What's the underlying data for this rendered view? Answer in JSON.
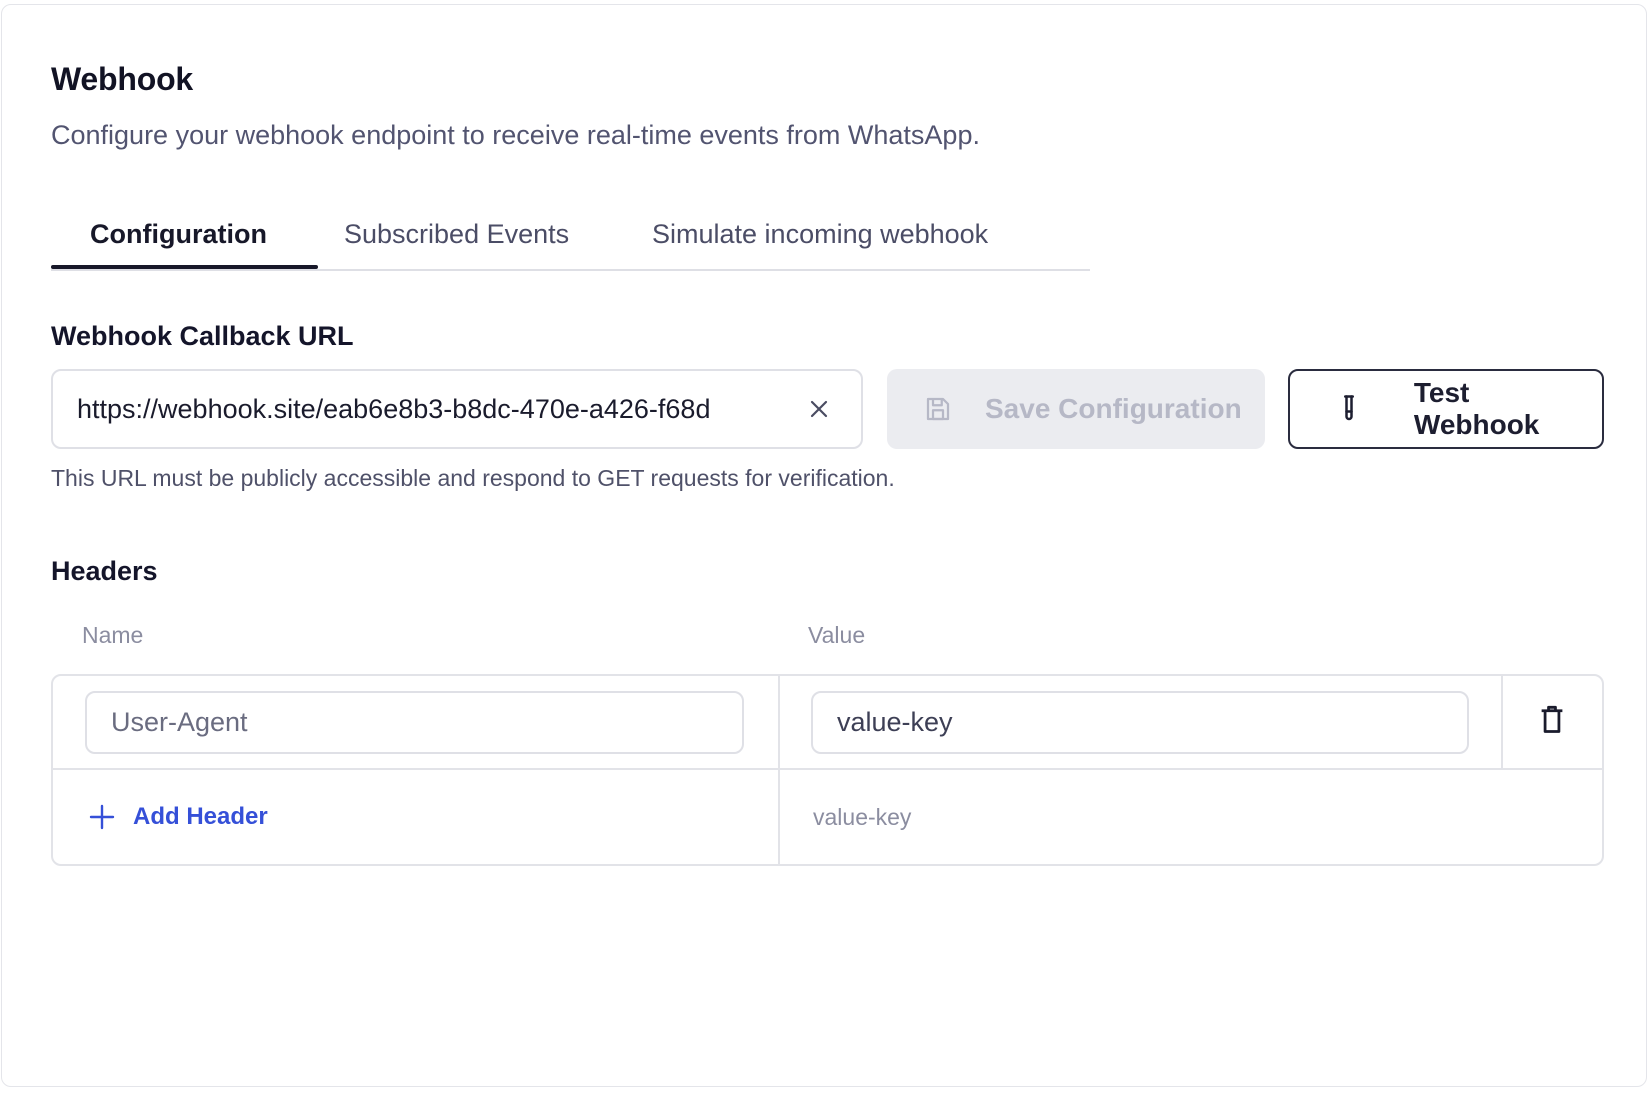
{
  "header": {
    "title": "Webhook",
    "subtitle": "Configure your webhook endpoint to receive real-time events from WhatsApp."
  },
  "tabs": [
    {
      "label": "Configuration",
      "active": true
    },
    {
      "label": "Subscribed Events",
      "active": false
    },
    {
      "label": "Simulate incoming webhook",
      "active": false
    }
  ],
  "callback": {
    "label": "Webhook Callback URL",
    "url_value": "https://webhook.site/eab6e8b3-b8dc-470e-a426-f68d",
    "helper": "This URL must be publicly accessible and respond to GET requests for verification.",
    "save_label": "Save Configuration",
    "save_icon": "floppy-disk-icon",
    "save_disabled": true,
    "test_label": "Test Webhook",
    "test_icon": "test-tube-icon"
  },
  "headers_section": {
    "label": "Headers",
    "columns": [
      "Name",
      "Value"
    ],
    "rows": [
      {
        "name": "User-Agent",
        "value": "value-key"
      }
    ],
    "add_label": "Add Header",
    "new_value_placeholder": "value-key"
  },
  "colors": {
    "accent": "#3550d8",
    "text_primary": "#14152a",
    "text_muted": "#8b8da0",
    "border": "#e2e3e8",
    "disabled_bg": "#ebecf0"
  }
}
